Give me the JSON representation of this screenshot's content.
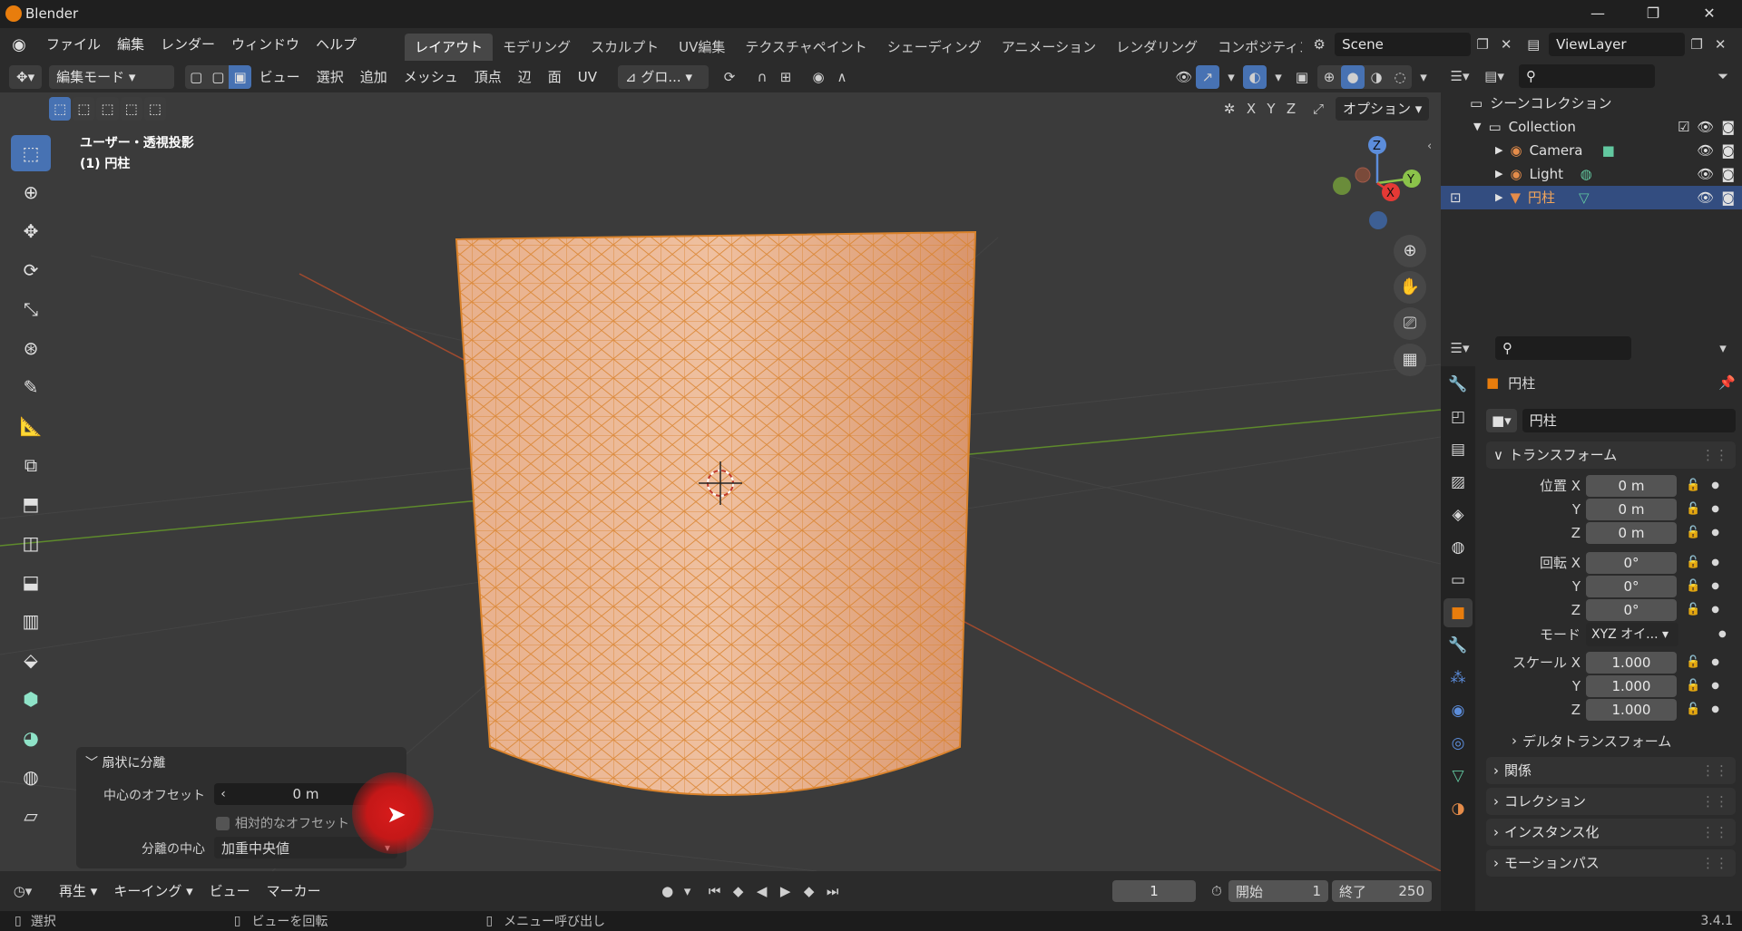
{
  "app": {
    "title": "Blender",
    "version": "3.4.1"
  },
  "menu": [
    "ファイル",
    "編集",
    "レンダー",
    "ウィンドウ",
    "ヘルプ"
  ],
  "workspaces": [
    "レイアウト",
    "モデリング",
    "スカルプト",
    "UV編集",
    "テクスチャペイント",
    "シェーディング",
    "アニメーション",
    "レンダリング",
    "コンポジティン:"
  ],
  "scene": {
    "name": "Scene",
    "view_layer": "ViewLayer"
  },
  "viewport_header": {
    "mode": "編集モード",
    "menus": [
      "ビュー",
      "選択",
      "追加",
      "メッシュ",
      "頂点",
      "辺",
      "面",
      "UV"
    ],
    "orientation": "グロ...",
    "axes": [
      "X",
      "Y",
      "Z"
    ],
    "options": "オプション"
  },
  "viewport": {
    "view_name": "ユーザー・透視投影",
    "object_info": "(1) 円柱",
    "gizmo": {
      "x": "X",
      "y": "Y",
      "z": "Z"
    }
  },
  "operator_panel": {
    "title": "扇状に分離",
    "offset_label": "中心のオフセット",
    "offset_value": "0 m",
    "relative_label": "相対的なオフセット",
    "center_label": "分離の中心",
    "center_value": "加重中央値"
  },
  "timeline": {
    "menus": [
      "再生",
      "キーイング",
      "ビュー",
      "マーカー"
    ],
    "current_frame": "1",
    "start_label": "開始",
    "start": "1",
    "end_label": "終了",
    "end": "250"
  },
  "statusbar": {
    "select": "選択",
    "rotate": "ビューを回転",
    "menu": "メニュー呼び出し"
  },
  "outliner": {
    "root": "シーンコレクション",
    "collection": "Collection",
    "items": [
      "Camera",
      "Light",
      "円柱"
    ]
  },
  "properties": {
    "object_name": "円柱",
    "name_field": "円柱",
    "transform_title": "トランスフォーム",
    "location_label": "位置 X",
    "rotation_label": "回転 X",
    "scale_label": "スケール X",
    "y": "Y",
    "z": "Z",
    "location": [
      "0 m",
      "0 m",
      "0 m"
    ],
    "rotation": [
      "0°",
      "0°",
      "0°"
    ],
    "mode_label": "モード",
    "mode_value": "XYZ オイ...",
    "scale": [
      "1.000",
      "1.000",
      "1.000"
    ],
    "delta": "デルタトランスフォーム",
    "sections": [
      "関係",
      "コレクション",
      "インスタンス化",
      "モーションパス"
    ]
  },
  "colors": {
    "accent": "#4772b3",
    "mesh": "#e8a468",
    "wire": "#d9822b",
    "orange": "#e87d0d"
  }
}
